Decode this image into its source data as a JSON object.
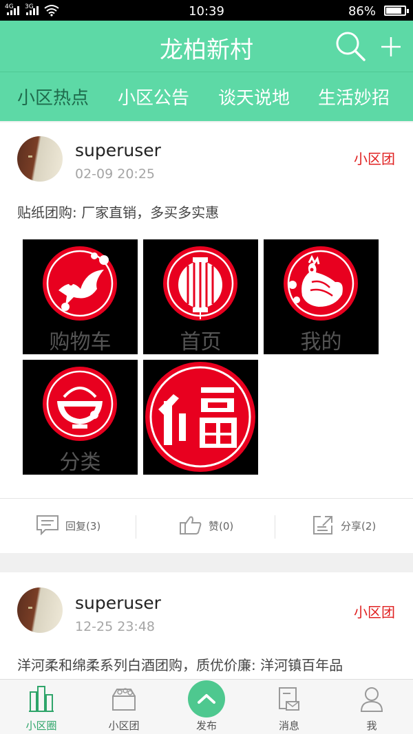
{
  "status_bar": {
    "net1": "4G",
    "net2": "3G",
    "time": "10:39",
    "battery": "86%"
  },
  "header": {
    "title": "龙柏新村",
    "search_icon": "search-icon",
    "add_icon": "plus-icon"
  },
  "tabs": [
    {
      "label": "小区热点",
      "active": true
    },
    {
      "label": "小区公告"
    },
    {
      "label": "谈天说地"
    },
    {
      "label": "生活妙招"
    }
  ],
  "posts": [
    {
      "user": "superuser",
      "time": "02-09 20:25",
      "tag": "小区团",
      "text": "贴纸团购: 厂家直销，多买多实惠",
      "images": [
        {
          "caption": "购物车",
          "icon": "bird-papercut-icon"
        },
        {
          "caption": "首页",
          "icon": "lantern-papercut-icon"
        },
        {
          "caption": "我的",
          "icon": "rooster-papercut-icon"
        },
        {
          "caption": "分类",
          "icon": "bowl-papercut-icon"
        },
        {
          "caption": "",
          "icon": "fu-papercut-icon"
        }
      ],
      "actions": {
        "reply": "回复(3)",
        "like": "赞(0)",
        "share": "分享(2)"
      }
    },
    {
      "user": "superuser",
      "time": "12-25 23:48",
      "tag": "小区团",
      "text": "洋河柔和绵柔系列白酒团购，质优价廉: 洋河镇百年品"
    }
  ],
  "bottom_nav": [
    {
      "label": "小区圈",
      "active": true
    },
    {
      "label": "小区团"
    },
    {
      "label": "发布"
    },
    {
      "label": "消息"
    },
    {
      "label": "我"
    }
  ],
  "colors": {
    "primary": "#5dd9a6",
    "tag_red": "#e02020",
    "active_nav": "#2fa56a"
  }
}
